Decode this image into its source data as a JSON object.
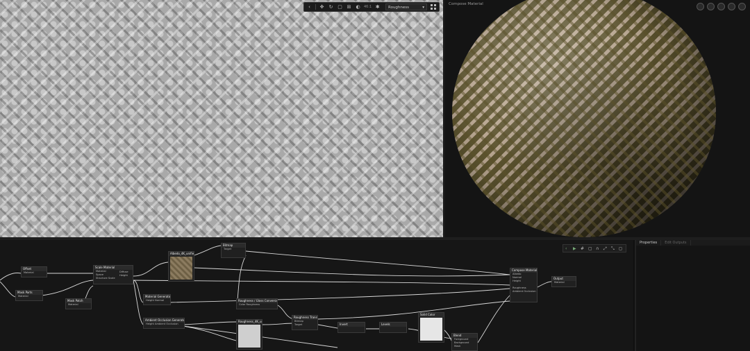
{
  "viewport2d": {
    "toolbar": {
      "zoom": "46:1",
      "channel_select": "Roughness",
      "buttons": [
        "collapse",
        "move",
        "rotate",
        "fit",
        "tiling",
        "color",
        "bright"
      ]
    }
  },
  "viewport3d": {
    "title": "Compose Material",
    "buttons": [
      "env",
      "lighting",
      "camera",
      "shading",
      "color-picker"
    ]
  },
  "graph": {
    "nodes": [
      {
        "id": "n1",
        "title": "Offset",
        "rows": [
          "Material"
        ]
      },
      {
        "id": "n2",
        "title": "Mask Parts",
        "rows": [
          "Material"
        ]
      },
      {
        "id": "n3",
        "title": "Scale Material",
        "rows": [
          "Material",
          "Space",
          "Structure Scale"
        ]
      },
      {
        "id": "n3b",
        "title": "",
        "rows": [
          "Diffuse",
          "Height"
        ]
      },
      {
        "id": "n4",
        "title": "Mask Patch",
        "rows": [
          "Material"
        ]
      },
      {
        "id": "n5",
        "title": "Albedo_4K_unified",
        "rows": []
      },
      {
        "id": "n6",
        "title": "Bitmap",
        "rows": [
          "Target",
          ""
        ]
      },
      {
        "id": "n7",
        "title": "Material Generator",
        "rows": [
          "Height  Normal"
        ]
      },
      {
        "id": "n8",
        "title": "Ambient Occlusion Generator",
        "rows": [
          "Height Ambient Occlusion"
        ]
      },
      {
        "id": "n9",
        "title": "Roughness / Gloss Conversion",
        "rows": [
          "Color    Roughness"
        ]
      },
      {
        "id": "n10",
        "title": "Roughness_4K_unif",
        "rows": []
      },
      {
        "id": "n11",
        "title": "Roughness Transfer",
        "rows": [
          "Bitmap",
          "Target"
        ]
      },
      {
        "id": "n12",
        "title": "Invert",
        "rows": [
          ""
        ]
      },
      {
        "id": "n13",
        "title": "Levels",
        "rows": [
          ""
        ]
      },
      {
        "id": "n14",
        "title": "Solid Color",
        "rows": []
      },
      {
        "id": "n15",
        "title": "Blend",
        "rows": [
          "Foreground",
          "Background",
          "Mask"
        ]
      },
      {
        "id": "n16",
        "title": "Compose Material",
        "rows": [
          "Albedo",
          "Normal",
          "Height",
          "",
          "Roughness",
          "Ambient Occlusion"
        ]
      },
      {
        "id": "n17",
        "title": "Output",
        "rows": [
          "Material"
        ]
      }
    ]
  },
  "properties": {
    "tabs": [
      "Properties",
      "Edit Outputs"
    ]
  }
}
